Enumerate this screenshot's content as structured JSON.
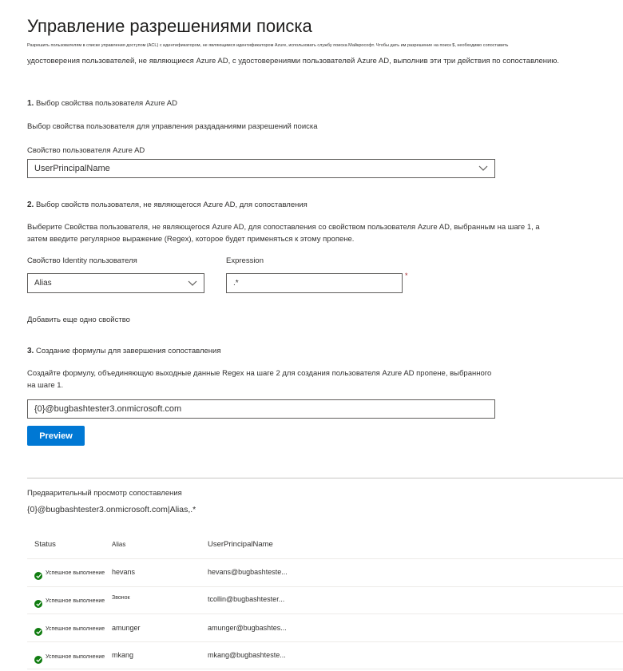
{
  "page": {
    "title": "Управление разрешениями поиска",
    "desc_line1": "Разрешить пользователям в списке управления доступом (ACL) с идентификатором, не являющимся идентификатором Azure, использовать службу поиска Майкрософт. Чтобы дать им разрешение на поиск $, необходимо сопоставить",
    "desc_line2": "удостоверения пользователей, не являющиеся Azure AD, с удостоверениями пользователей Azure AD, выполнив эти три действия по сопоставлению."
  },
  "step1": {
    "number": "1.",
    "title": "Выбор свойства пользователя Azure AD",
    "description": "Выбор свойства пользователя для управления раздаданиями разрешений поиска",
    "field_label": "Свойство пользователя Azure AD",
    "field_value": "UserPrincipalName"
  },
  "step2": {
    "number": "2.",
    "title": "Выбор свойств пользователя, не являющегося Azure AD, для сопоставления",
    "description_line1": "Выберите Свойства пользователя, не являющегося Azure AD, для сопоставления со свойством пользователя Azure AD, выбранным на шаге 1, а",
    "description_line2": "затем введите регулярное выражение (Regex), которое будет применяться к этому пропене.",
    "identity_label": "Свойство Identity пользователя",
    "identity_value": "Alias",
    "expression_label": "Expression",
    "expression_value": ".*",
    "required_mark": "*",
    "add_property": "Добавить еще одно свойство"
  },
  "step3": {
    "number": "3.",
    "title": "Создание формулы для завершения сопоставления",
    "description_line1": "Создайте формулу, объединяющую выходные данные Regex на шаге 2 для создания пользователя Azure AD пропене, выбранного",
    "description_line2": "на шаге 1.",
    "formula_value": "{0}@bugbashtester3.onmicrosoft.com",
    "preview_button": "Preview"
  },
  "preview": {
    "title": "Предварительный просмотр сопоставления",
    "formula": "{0}@bugbashtester3.onmicrosoft.com|Alias,.*",
    "columns": [
      "Status",
      "Alias",
      "UserPrincipalName"
    ],
    "rows": [
      {
        "status": "Успешное выполнение",
        "alias": "hevans",
        "upn": "hevans@bugbashteste..."
      },
      {
        "status": "Успешное выполнение",
        "alias": "Звонок",
        "upn": "tcollin@bugbashtester..."
      },
      {
        "status": "Успешное выполнение",
        "alias": "amunger",
        "upn": "amunger@bugbashtes..."
      },
      {
        "status": "Успешное выполнение",
        "alias": "mkang",
        "upn": "mkang@bugbashteste..."
      }
    ]
  },
  "colors": {
    "accent": "#0078d4",
    "success": "#107c10",
    "required": "#a4262c"
  }
}
